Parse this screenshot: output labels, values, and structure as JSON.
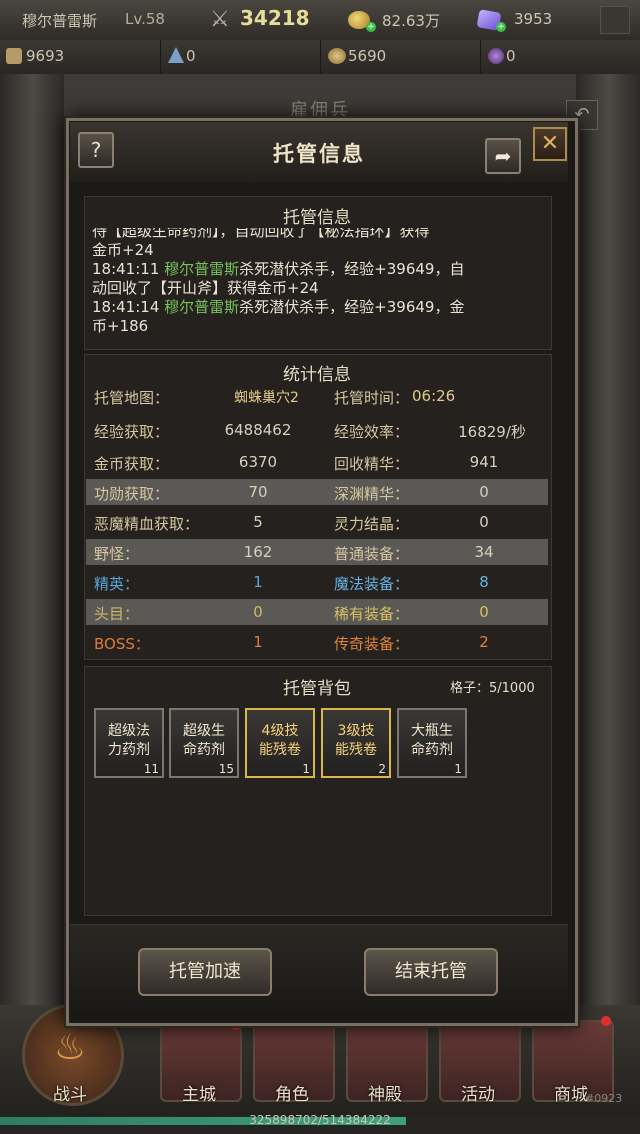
{
  "topbar": {
    "player_name": "穆尔普雷斯",
    "level": "Lv.58",
    "power": "34218",
    "gold": "82.63万",
    "diamonds": "3953"
  },
  "resources": {
    "r1": "9693",
    "r2": "0",
    "r3": "5690",
    "r4": "0"
  },
  "background": {
    "title": "雇佣兵"
  },
  "dialog": {
    "title": "托管信息",
    "help": "?",
    "share_icon": "share-icon",
    "close": "✕",
    "log_section": {
      "title": "托管信息",
      "lines": [
        {
          "text": "待【超级生命药剂】，自动回收了【秘法指环】获得"
        },
        {
          "text": "金币+24"
        },
        {
          "time": "18:41:11",
          "name": "穆尔普雷斯",
          "rest": "杀死潜伏杀手，经验+39649，自"
        },
        {
          "text": "动回收了【开山斧】获得金币+24"
        },
        {
          "time": "18:41:14",
          "name": "穆尔普雷斯",
          "rest": "杀死潜伏杀手，经验+39649，金"
        },
        {
          "text": "币+186"
        }
      ]
    },
    "stats": {
      "title": "统计信息",
      "map_label": "托管地图：",
      "map_value": "蜘蛛巢穴2",
      "time_label": "托管时间：",
      "time_value": "06:26",
      "rows": [
        {
          "l1": "经验获取：",
          "v1": "6488462",
          "l2": "经验效率：",
          "v2": "16829/秒"
        },
        {
          "l1": "金币获取：",
          "v1": "6370",
          "l2": "回收精华：",
          "v2": "941"
        },
        {
          "l1": "功勋获取：",
          "v1": "70",
          "l2": "深渊精华：",
          "v2": "0"
        },
        {
          "l1": "恶魔精血获取：",
          "v1": "5",
          "l2": "灵力结晶：",
          "v2": "0"
        },
        {
          "l1": "野怪：",
          "v1": "162",
          "l2": "普通装备：",
          "v2": "34"
        },
        {
          "l1": "精英：",
          "v1": "1",
          "l2": "魔法装备：",
          "v2": "8"
        },
        {
          "l1": "头目：",
          "v1": "0",
          "l2": "稀有装备：",
          "v2": "0"
        },
        {
          "l1": "BOSS：",
          "v1": "1",
          "l2": "传奇装备：",
          "v2": "2"
        }
      ]
    },
    "bag": {
      "title": "托管背包",
      "capacity": "格子：5/1000",
      "items": [
        {
          "line1": "超级法",
          "line2": "力药剂",
          "count": "11"
        },
        {
          "line1": "超级生",
          "line2": "命药剂",
          "count": "15"
        },
        {
          "line1": "4级技",
          "line2": "能残卷",
          "count": "1"
        },
        {
          "line1": "3级技",
          "line2": "能残卷",
          "count": "2"
        },
        {
          "line1": "大瓶生",
          "line2": "命药剂",
          "count": "1"
        }
      ]
    },
    "buttons": {
      "speedup": "托管加速",
      "end": "结束托管"
    }
  },
  "nav": {
    "battle": "战斗",
    "city": "主城",
    "role": "角色",
    "temple": "神殿",
    "activity": "活动",
    "shop": "商城",
    "corner": "#0923"
  },
  "exp": {
    "text": "325898702/514384222",
    "fraction": 0.634
  },
  "colors": {
    "green_name": "#79c25a",
    "elite": "#5aa6d6",
    "magic": "#6ab0e0",
    "boss": "#e07a3a",
    "legend": "#e0843a",
    "gold_item": "#d8b84a"
  }
}
